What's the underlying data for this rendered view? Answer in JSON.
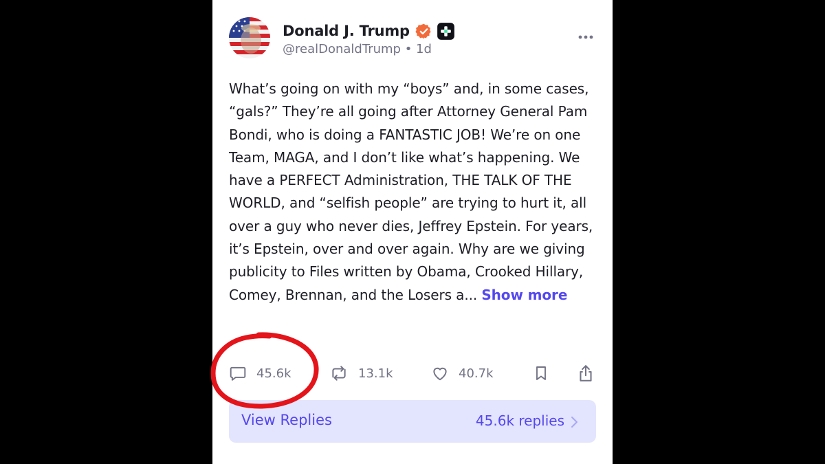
{
  "post": {
    "author": {
      "display_name": "Donald J. Trump",
      "handle": "@realDonaldTrump",
      "time_ago": "1d",
      "avatar_icon": "avatar-flag-portrait",
      "verified_icon": "verified-badge-icon",
      "badge_icon": "plus-badge-icon"
    },
    "text": "What’s going on with my “boys” and, in some cases, “gals?” They’re all going after Attorney General Pam Bondi, who is doing a FANTASTIC JOB! We’re on one Team, MAGA, and I don’t like what’s happening. We have a PERFECT Administration, THE TALK OF THE WORLD, and “selfish people” are trying to hurt it, all over a guy who never dies, Jeffrey Epstein. For years, it’s Epstein, over and over again. Why are we giving publicity to Files written by Obama, Crooked Hillary, Comey, Brennan, and the Losers a...",
    "show_more_label": "Show more",
    "actions": {
      "replies": "45.6k",
      "retruths": "13.1k",
      "likes": "40.7k"
    },
    "replies_bar": {
      "label": "View Replies",
      "count_label": "45.6k replies"
    }
  },
  "colors": {
    "accent": "#5448ee",
    "text": "#1d1d25",
    "muted": "#737386",
    "replies_bg": "#e3e4fd",
    "annotation": "#e4141b",
    "verified": "#f26b3a"
  }
}
